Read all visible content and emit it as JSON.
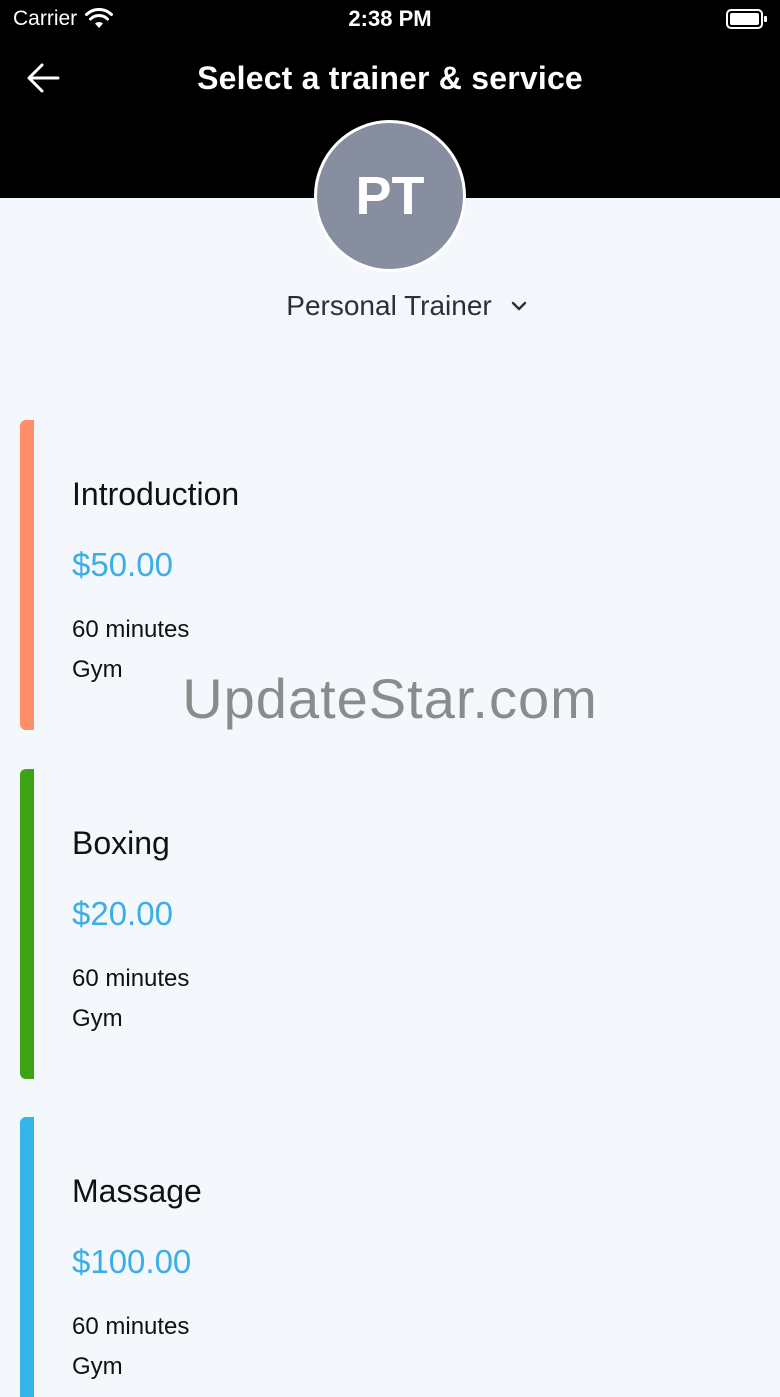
{
  "status_bar": {
    "carrier": "Carrier",
    "time": "2:38 PM",
    "wifi_icon": "wifi-icon",
    "battery_icon": "battery-icon"
  },
  "nav": {
    "back_icon": "arrow-left-icon",
    "title": "Select a trainer & service"
  },
  "trainer": {
    "initials": "PT",
    "name": "Personal Trainer",
    "dropdown_icon": "chevron-down-icon"
  },
  "services": [
    {
      "name": "Introduction",
      "price": "$50.00",
      "duration": "60 minutes",
      "location": "Gym",
      "color": "#ff8f66"
    },
    {
      "name": "Boxing",
      "price": "$20.00",
      "duration": "60 minutes",
      "location": "Gym",
      "color": "#3ba314"
    },
    {
      "name": "Massage",
      "price": "$100.00",
      "duration": "60 minutes",
      "location": "Gym",
      "color": "#33b5ea"
    }
  ],
  "colors": {
    "header_bg": "#000000",
    "page_bg": "#f4f8fc",
    "price": "#3aaee6",
    "avatar_bg": "#868ea0"
  },
  "watermark": "UpdateStar.com"
}
